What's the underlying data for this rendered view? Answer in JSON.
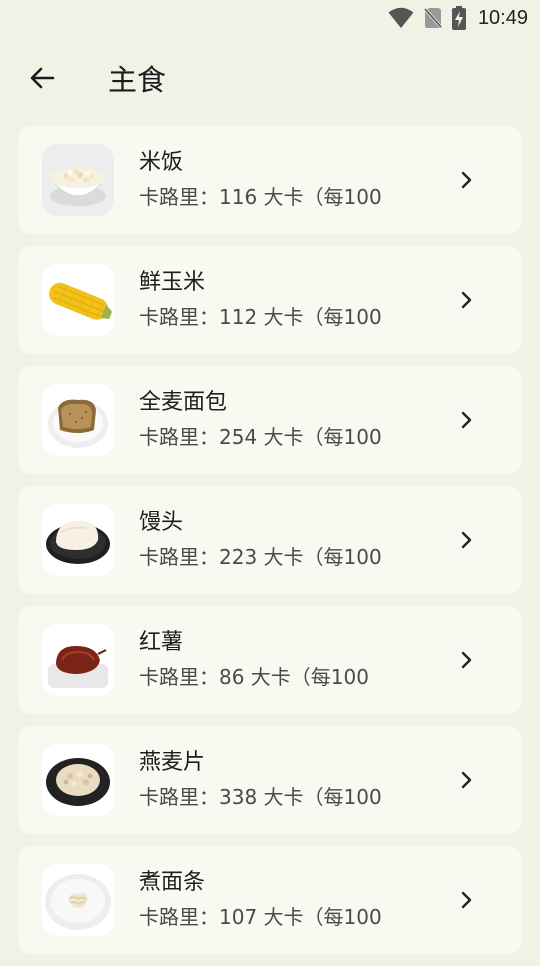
{
  "status_bar": {
    "time": "10:49",
    "icons": [
      "wifi-icon",
      "no-sim-icon",
      "battery-charging-icon"
    ]
  },
  "header": {
    "back_icon": "arrow-left-icon",
    "title": "主食"
  },
  "foods": [
    {
      "name": "米饭",
      "calories": "卡路里：116 大卡（每100",
      "image": "rice-bowl"
    },
    {
      "name": "鲜玉米",
      "calories": "卡路里：112 大卡（每100",
      "image": "corn"
    },
    {
      "name": "全麦面包",
      "calories": "卡路里：254 大卡（每100",
      "image": "whole-wheat-bread"
    },
    {
      "name": "馒头",
      "calories": "卡路里：223 大卡（每100",
      "image": "steamed-bun"
    },
    {
      "name": "红薯",
      "calories": "卡路里：86 大卡（每100",
      "image": "sweet-potato"
    },
    {
      "name": "燕麦片",
      "calories": "卡路里：338 大卡（每100",
      "image": "oatmeal"
    },
    {
      "name": "煮面条",
      "calories": "卡路里：107 大卡（每100",
      "image": "boiled-noodles"
    }
  ]
}
